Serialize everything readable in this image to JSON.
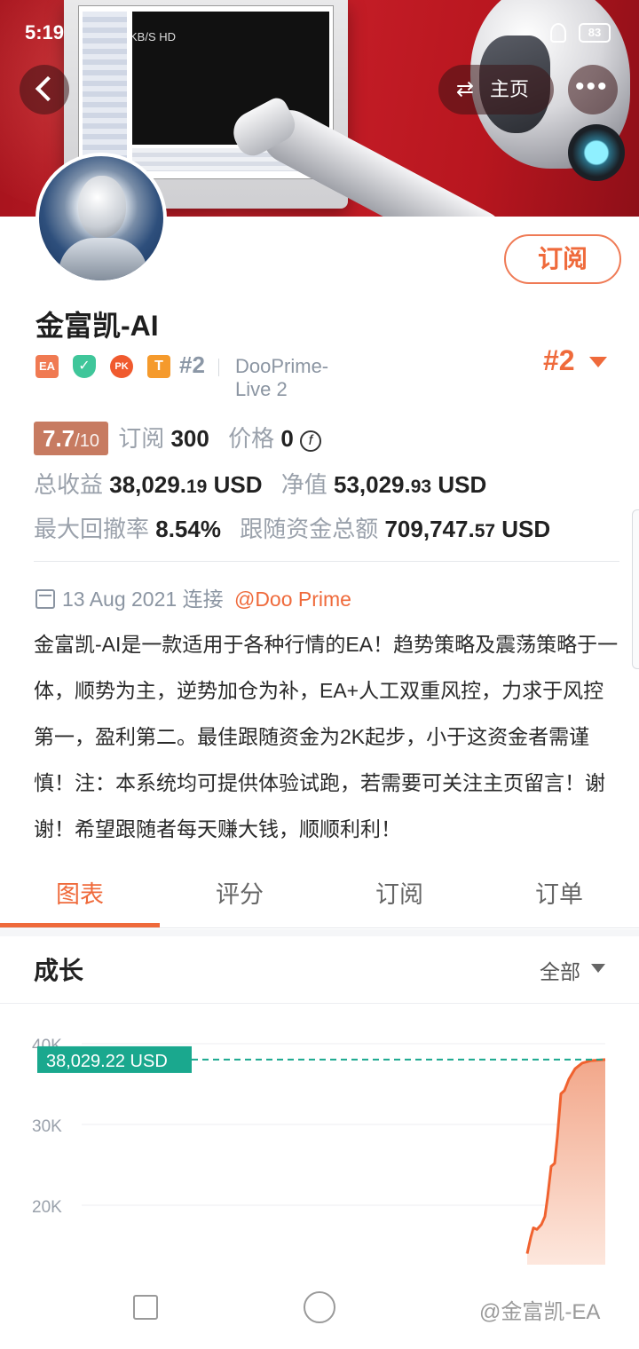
{
  "status_bar": {
    "time": "5:19",
    "network": "KB/S HD",
    "battery": "83"
  },
  "header": {
    "back_icon": "chevron-left-icon",
    "home_label": "主页",
    "home_icon": "swap-arrows-icon",
    "more_icon": "more-dots-icon"
  },
  "profile": {
    "name": "金富凯-AI",
    "subscribe_label": "订阅",
    "badges": [
      "EA",
      "✓",
      "PK",
      "T"
    ],
    "rank_small": "#2",
    "server": "DooPrime-Live 2",
    "rank_big": "#2"
  },
  "stats": {
    "score": "7.7",
    "score_denominator": "/10",
    "subscriptions_label": "订阅",
    "subscriptions_value": "300",
    "price_label": "价格",
    "price_value": "0",
    "total_profit_label": "总收益",
    "total_profit_int": "38,029.",
    "total_profit_dec": "19",
    "total_profit_unit": "USD",
    "equity_label": "净值",
    "equity_int": "53,029.",
    "equity_dec": "93",
    "equity_unit": "USD",
    "drawdown_label": "最大回撤率",
    "drawdown_value": "8.54%",
    "follow_funds_label": "跟随资金总额",
    "follow_funds_int": "709,747.",
    "follow_funds_dec": "57",
    "follow_funds_unit": "USD"
  },
  "connection": {
    "date": "13 Aug 2021",
    "connected_label": "连接",
    "broker": "@Doo Prime"
  },
  "description": "金富凯-AI是一款适用于各种行情的EA！趋势策略及震荡策略于一体，顺势为主，逆势加仓为补，EA+人工双重风控，力求于风控第一，盈利第二。最佳跟随资金为2K起步，小于这资金者需谨慎！注：本系统均可提供体验试跑，若需要可关注主页留言！谢谢！希望跟随者每天赚大钱，顺顺利利！",
  "tabs": [
    {
      "label": "图表",
      "active": true
    },
    {
      "label": "评分",
      "active": false
    },
    {
      "label": "订阅",
      "active": false
    },
    {
      "label": "订单",
      "active": false
    }
  ],
  "growth": {
    "title": "成长",
    "range_label": "全部"
  },
  "chart_data": {
    "type": "area",
    "title": "",
    "xlabel": "",
    "ylabel": "",
    "y_ticks": [
      "40K",
      "30K",
      "20K"
    ],
    "ylim": [
      14000,
      42000
    ],
    "current_value_label": "38,029.22 USD",
    "current_value": 38029.22,
    "series": [
      {
        "values": [
          14000,
          16000,
          17200,
          17000,
          17600,
          18600,
          21000,
          24800,
          25200,
          28500,
          33800,
          34200,
          35600,
          36900,
          37600,
          37900,
          38029.22
        ]
      }
    ],
    "colors": {
      "line": "#f0622f",
      "fill_top": "#f2a78a",
      "fill_bottom": "#fde7dd",
      "reference": "#1aa88e"
    }
  },
  "nav": {
    "watermark": "@金富凯-EA"
  }
}
